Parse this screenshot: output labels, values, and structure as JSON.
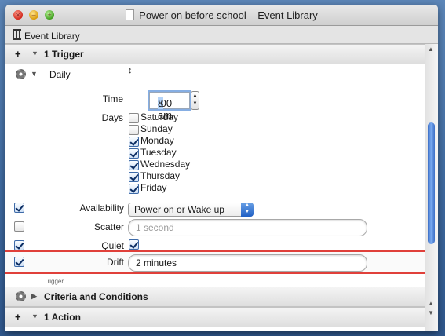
{
  "window": {
    "title": "Power on before school – Event Library",
    "traffic": [
      "close",
      "minimize",
      "zoom"
    ]
  },
  "toolbar": {
    "library_label": "Event Library"
  },
  "trigger_section": {
    "plus": "+",
    "label": "1 Trigger",
    "trigger_type": "Daily",
    "trigger_type_arrows": "↕",
    "time_label": "Time",
    "time_hour": "8",
    "time_rest": ":00 am",
    "days_label": "Days",
    "days": [
      {
        "name": "Saturday",
        "checked": false
      },
      {
        "name": "Sunday",
        "checked": false
      },
      {
        "name": "Monday",
        "checked": true
      },
      {
        "name": "Tuesday",
        "checked": true
      },
      {
        "name": "Wednesday",
        "checked": true
      },
      {
        "name": "Thursday",
        "checked": true
      },
      {
        "name": "Friday",
        "checked": true
      }
    ],
    "availability_label": "Availability",
    "availability_value": "Power on or Wake up",
    "scatter_label": "Scatter",
    "scatter_placeholder": "1 second",
    "quiet_label": "Quiet",
    "drift_label": "Drift",
    "drift_value": "2 minutes",
    "footer_label": "Trigger"
  },
  "criteria_section": {
    "label": "Criteria and Conditions"
  },
  "action_section": {
    "plus": "+",
    "label": "1 Action"
  },
  "colors": {
    "accent": "#3d7be0",
    "highlight_border": "#e0403a"
  }
}
